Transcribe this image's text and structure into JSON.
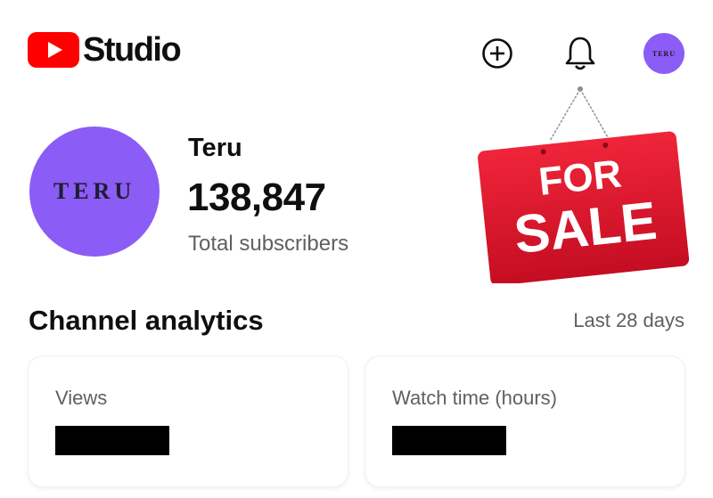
{
  "header": {
    "app_name": "Studio",
    "create_icon": "add-circle-icon",
    "notifications_icon": "bell-icon",
    "account_avatar_text": "TERU"
  },
  "channel": {
    "avatar_text": "TERU",
    "name": "Teru",
    "subscriber_count": "138,847",
    "subscriber_label": "Total subscribers"
  },
  "sale_sign": {
    "line1": "FOR",
    "line2": "SALE"
  },
  "analytics": {
    "title": "Channel analytics",
    "period": "Last 28 days",
    "cards": [
      {
        "label": "Views"
      },
      {
        "label": "Watch time (hours)"
      }
    ]
  },
  "colors": {
    "brand_red": "#ff0000",
    "avatar_purple": "#8b5cf6",
    "sign_red": "#e0142b"
  }
}
